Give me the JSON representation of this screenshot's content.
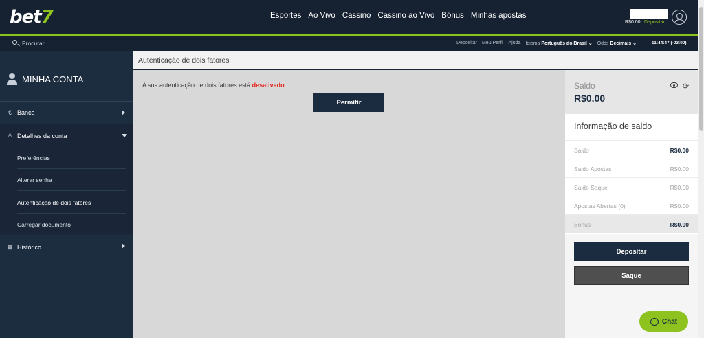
{
  "header": {
    "logo_text": "bet",
    "logo_accent": "7",
    "nav": [
      "Esportes",
      "Ao Vivo",
      "Cassino",
      "Cassino ao Vivo",
      "Bônus",
      "Minhas apostas"
    ],
    "balance": "R$0.00",
    "deposit_link": "Depositar",
    "user_icon": "user-circle-icon"
  },
  "subbar": {
    "search_placeholder": "Procurar",
    "links": {
      "deposit": "Depositar",
      "profile": "Meu Perfil",
      "help": "Ajuda",
      "language_label": "Idioma",
      "language_value": "Português do Brasil",
      "odds_label": "Odds",
      "odds_value": "Decimais"
    },
    "clock": "11:44:47 (-03:00)"
  },
  "sidebar": {
    "title": "MINHA CONTA",
    "items": [
      {
        "label": "Banco",
        "icon": "euro-icon"
      },
      {
        "label": "Detalhes da conta",
        "icon": "user-icon"
      },
      {
        "label": "Histórico",
        "icon": "calendar-icon"
      }
    ],
    "subitems": [
      "Preferências",
      "Alterar senha",
      "Autenticação de dois fatores",
      "Carregar documento"
    ],
    "active_subitem": "Autenticação de dois fatores"
  },
  "main": {
    "title": "Autenticação de dois fatores",
    "message_prefix": "A sua autenticação de dois fatores está",
    "message_status": "desativado",
    "permit_button": "Permitir"
  },
  "right_panel": {
    "saldo_label": "Saldo",
    "saldo_value": "R$0.00",
    "info_title": "Informação de saldo",
    "rows": [
      {
        "label": "Saldo",
        "value": "R$0.00"
      },
      {
        "label": "Saldo Apostas",
        "value": "R$0.00"
      },
      {
        "label": "Saldo Saque",
        "value": "R$0.00"
      },
      {
        "label": "Apostas Abertas (0)",
        "value": "R$0.00"
      },
      {
        "label": "Bonus",
        "value": "R$0.00"
      }
    ],
    "deposit_button": "Depositar",
    "withdraw_button": "Saque"
  },
  "chat": {
    "label": "Chat"
  },
  "colors": {
    "accent": "#8dc21f",
    "navy": "#1c2c40",
    "status_off": "#e5231b"
  }
}
